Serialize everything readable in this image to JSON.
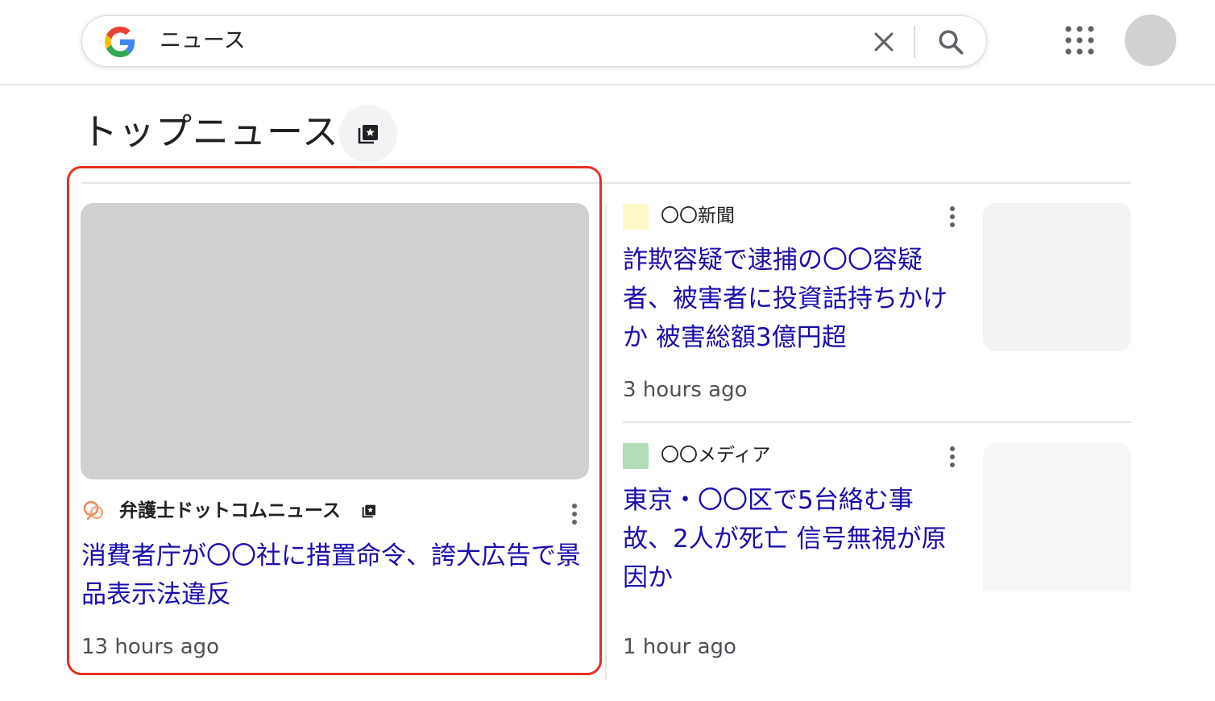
{
  "search": {
    "query": "ニュース"
  },
  "section": {
    "title": "トップニュース"
  },
  "featured": {
    "source": "弁護士ドットコムニュース",
    "headline": "消費者庁が〇〇社に措置命令、誇大広告で景品表示法違反",
    "time": "13 hours ago"
  },
  "stories": [
    {
      "source": "〇〇新聞",
      "source_color": "#fdf8c8",
      "headline": "詐欺容疑で逮捕の〇〇容疑者、被害者に投資話持ちかけか 被害総額3億円超",
      "time": "3 hours ago"
    },
    {
      "source": "〇〇メディア",
      "source_color": "#b3dfb8",
      "headline": "東京・〇〇区で5台絡む事故、2人が死亡 信号無視が原因か",
      "time": "1 hour ago"
    }
  ],
  "colors": {
    "link": "#1a0dab",
    "highlight_border": "#e8301f",
    "placeholder_gray": "#d0d0d0"
  },
  "icons": [
    "google-g-icon",
    "close-icon",
    "search-icon",
    "apps-grid-icon",
    "collection-star-icon",
    "more-vert-icon"
  ]
}
